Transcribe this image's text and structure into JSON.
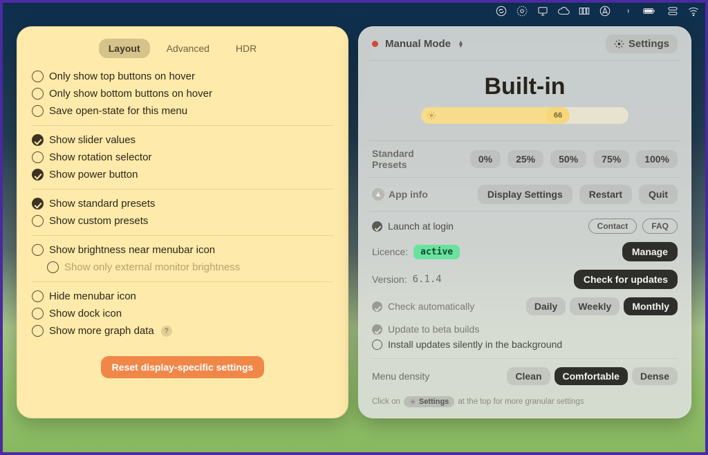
{
  "menubar_icons": [
    "updates",
    "preferences",
    "display",
    "cloud",
    "disks",
    "location",
    "volume",
    "battery",
    "control-center",
    "wifi"
  ],
  "left": {
    "tabs": [
      "Layout",
      "Advanced",
      "HDR"
    ],
    "active_tab": 0,
    "groups": [
      [
        {
          "label": "Only show top buttons on hover",
          "checked": false
        },
        {
          "label": "Only show bottom buttons on hover",
          "checked": false
        },
        {
          "label": "Save open-state for this menu",
          "checked": false
        }
      ],
      [
        {
          "label": "Show slider values",
          "checked": true
        },
        {
          "label": "Show rotation selector",
          "checked": false
        },
        {
          "label": "Show power button",
          "checked": true
        }
      ],
      [
        {
          "label": "Show standard presets",
          "checked": true
        },
        {
          "label": "Show custom presets",
          "checked": false
        }
      ],
      [
        {
          "label": "Show brightness near menubar icon",
          "checked": false
        },
        {
          "label": "Show only external monitor brightness",
          "checked": false,
          "sub": true
        }
      ],
      [
        {
          "label": "Hide menubar icon",
          "checked": false
        },
        {
          "label": "Show dock icon",
          "checked": false
        },
        {
          "label": "Show more graph data",
          "checked": false,
          "help": true
        }
      ]
    ],
    "reset_label": "Reset display-specific settings"
  },
  "right": {
    "mode_label": "Manual Mode",
    "settings_label": "Settings",
    "display_name": "Built-in",
    "brightness": 66,
    "presets_label_1": "Standard",
    "presets_label_2": "Presets",
    "presets": [
      "0%",
      "25%",
      "50%",
      "75%",
      "100%"
    ],
    "app_info_label": "App info",
    "actions": [
      "Display Settings",
      "Restart",
      "Quit"
    ],
    "launch_label": "Launch at login",
    "launch_checked": true,
    "contact_label": "Contact",
    "faq_label": "FAQ",
    "licence_label": "Licence:",
    "licence_state": "active",
    "manage_label": "Manage",
    "version_label": "Version:",
    "version": "6.1.4",
    "check_updates_label": "Check for updates",
    "check_auto_label": "Check automatically",
    "check_auto_checked": true,
    "intervals": [
      "Daily",
      "Weekly",
      "Monthly"
    ],
    "interval_active": 2,
    "beta_label": "Update to beta builds",
    "beta_checked": true,
    "silent_label": "Install updates silently in the background",
    "silent_checked": false,
    "density_label": "Menu density",
    "density_options": [
      "Clean",
      "Comfortable",
      "Dense"
    ],
    "density_active": 1,
    "hint_prefix": "Click on",
    "hint_chip": "Settings",
    "hint_suffix": "at the top for more granular settings"
  }
}
